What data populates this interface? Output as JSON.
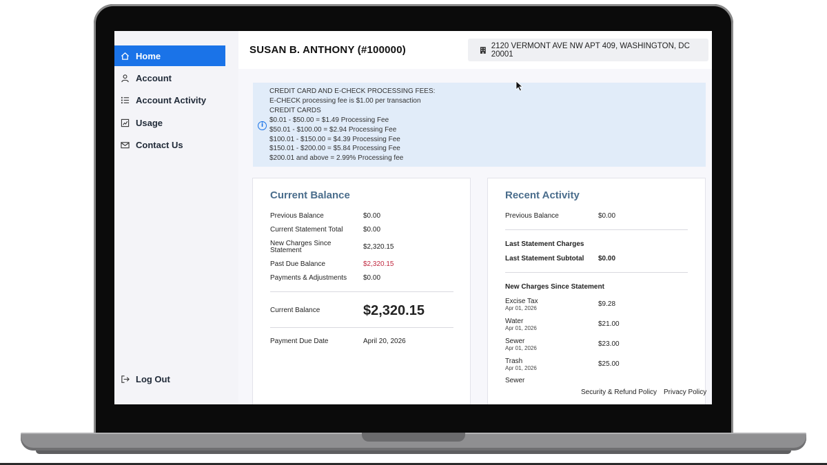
{
  "sidebar": {
    "items": [
      {
        "label": "Home",
        "icon": "home-icon"
      },
      {
        "label": "Account",
        "icon": "user-icon"
      },
      {
        "label": "Account Activity",
        "icon": "list-icon"
      },
      {
        "label": "Usage",
        "icon": "chart-icon"
      },
      {
        "label": "Contact Us",
        "icon": "mail-icon"
      }
    ],
    "logout": {
      "label": "Log Out",
      "icon": "logout-icon"
    },
    "active_color": "#1a73e8"
  },
  "header": {
    "account_name": "SUSAN B. ANTHONY (#100000)",
    "address": "2120 VERMONT AVE NW APT 409, WASHINGTON, DC 20001"
  },
  "banner": {
    "lines": [
      "CREDIT CARD AND E-CHECK PROCESSING FEES:",
      "E-CHECK processing fee is $1.00 per transaction",
      "CREDIT CARDS",
      "$0.01 - $50.00 = $1.49 Processing Fee",
      "$50.01 - $100.00 = $2.94 Processing Fee",
      "$100.01 - $150.00 = $4.39 Processing Fee",
      "$150.01 - $200.00 = $5.84 Processing Fee",
      "$200.01 and above = 2.99% Processing fee"
    ]
  },
  "current_balance": {
    "title": "Current Balance",
    "rows": [
      {
        "label": "Previous Balance",
        "value": "$0.00"
      },
      {
        "label": "Current Statement Total",
        "value": "$0.00"
      },
      {
        "label": "New Charges Since Statement",
        "value": "$2,320.15"
      },
      {
        "label": "Past Due Balance",
        "value": "$2,320.15"
      },
      {
        "label": "Payments & Adjustments",
        "value": "$0.00"
      }
    ],
    "balance_label": "Current Balance",
    "balance_value": "$2,320.15",
    "due_label": "Payment Due Date",
    "due_value": "April 20, 2026",
    "past_due_color": "#c0283f"
  },
  "recent_activity": {
    "title": "Recent Activity",
    "previous_label": "Previous Balance",
    "previous_value": "$0.00",
    "last_statement_heading": "Last Statement Charges",
    "last_subtotal_label": "Last Statement Subtotal",
    "last_subtotal_value": "$0.00",
    "new_charges_heading": "New Charges Since Statement",
    "charges": [
      {
        "label": "Excise Tax",
        "date": "Apr 01, 2026",
        "value": "$9.28"
      },
      {
        "label": "Water",
        "date": "Apr 01, 2026",
        "value": "$21.00"
      },
      {
        "label": "Sewer",
        "date": "Apr 01, 2026",
        "value": "$23.00"
      },
      {
        "label": "Trash",
        "date": "Apr 01, 2026",
        "value": "$25.00"
      },
      {
        "label": "Sewer",
        "date": "",
        "value": ""
      }
    ]
  },
  "footer": {
    "security_link": "Security & Refund Policy",
    "privacy_link": "Privacy Policy"
  },
  "colors": {
    "title_color": "#4a6d8c",
    "banner_bg": "#e1ecf9"
  }
}
